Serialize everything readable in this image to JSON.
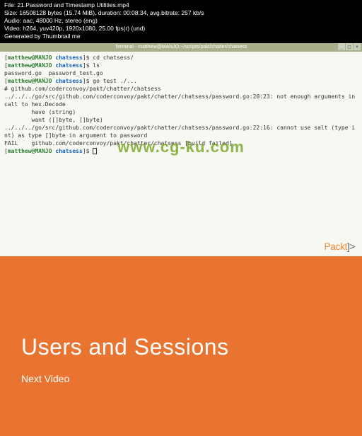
{
  "header": {
    "line1": "File: 21.Password and Timestamp Utilities.mp4",
    "line2": "Size: 16508128 bytes (15.74 MiB), duration: 00:08:34, avg.bitrate: 257 kb/s",
    "line3": "Audio: aac, 48000 Hz, stereo (eng)",
    "line4": "Video: h264, yuv420p, 1920x1080, 25.00 fps(r) (und)",
    "line5": "Generated by Thumbnail me"
  },
  "terminal": {
    "title": "Terminal - matthew@MANJO:~/scripts/pakt/chatter/chatsess",
    "min_icon": "_",
    "max_icon": "□",
    "close_icon": "×",
    "lines": {
      "u1": "matthew@MANJO",
      "p1": " chatsess",
      "c1": "]$ cd chatsess/",
      "c2": "]$ ls",
      "l1": "password.go  password_test.go",
      "c3": "]$ go test ./...",
      "l2": "# github.com/coderconvoy/pakt/chatter/chatsess",
      "l3": "../../../go/src/github.com/coderconvoy/pakt/chatter/chatsess/password.go:20:23: not enough arguments in call to hex.Decode",
      "l4": "        have (string)",
      "l5": "        want ([]byte, []byte)",
      "l6": "../../../go/src/github.com/coderconvoy/pakt/chatter/chatsess/password.go:22:16: cannot use salt (type int) as type []byte in argument to password",
      "l7": "FAIL    github.com/coderconvoy/pakt/chatter/chatsess [build failed]"
    }
  },
  "watermark": "www.cg-ku.com",
  "packt": {
    "name": "Packt",
    "closing": "]>"
  },
  "panel": {
    "title": "Users and Sessions",
    "sub": "Next Video"
  }
}
